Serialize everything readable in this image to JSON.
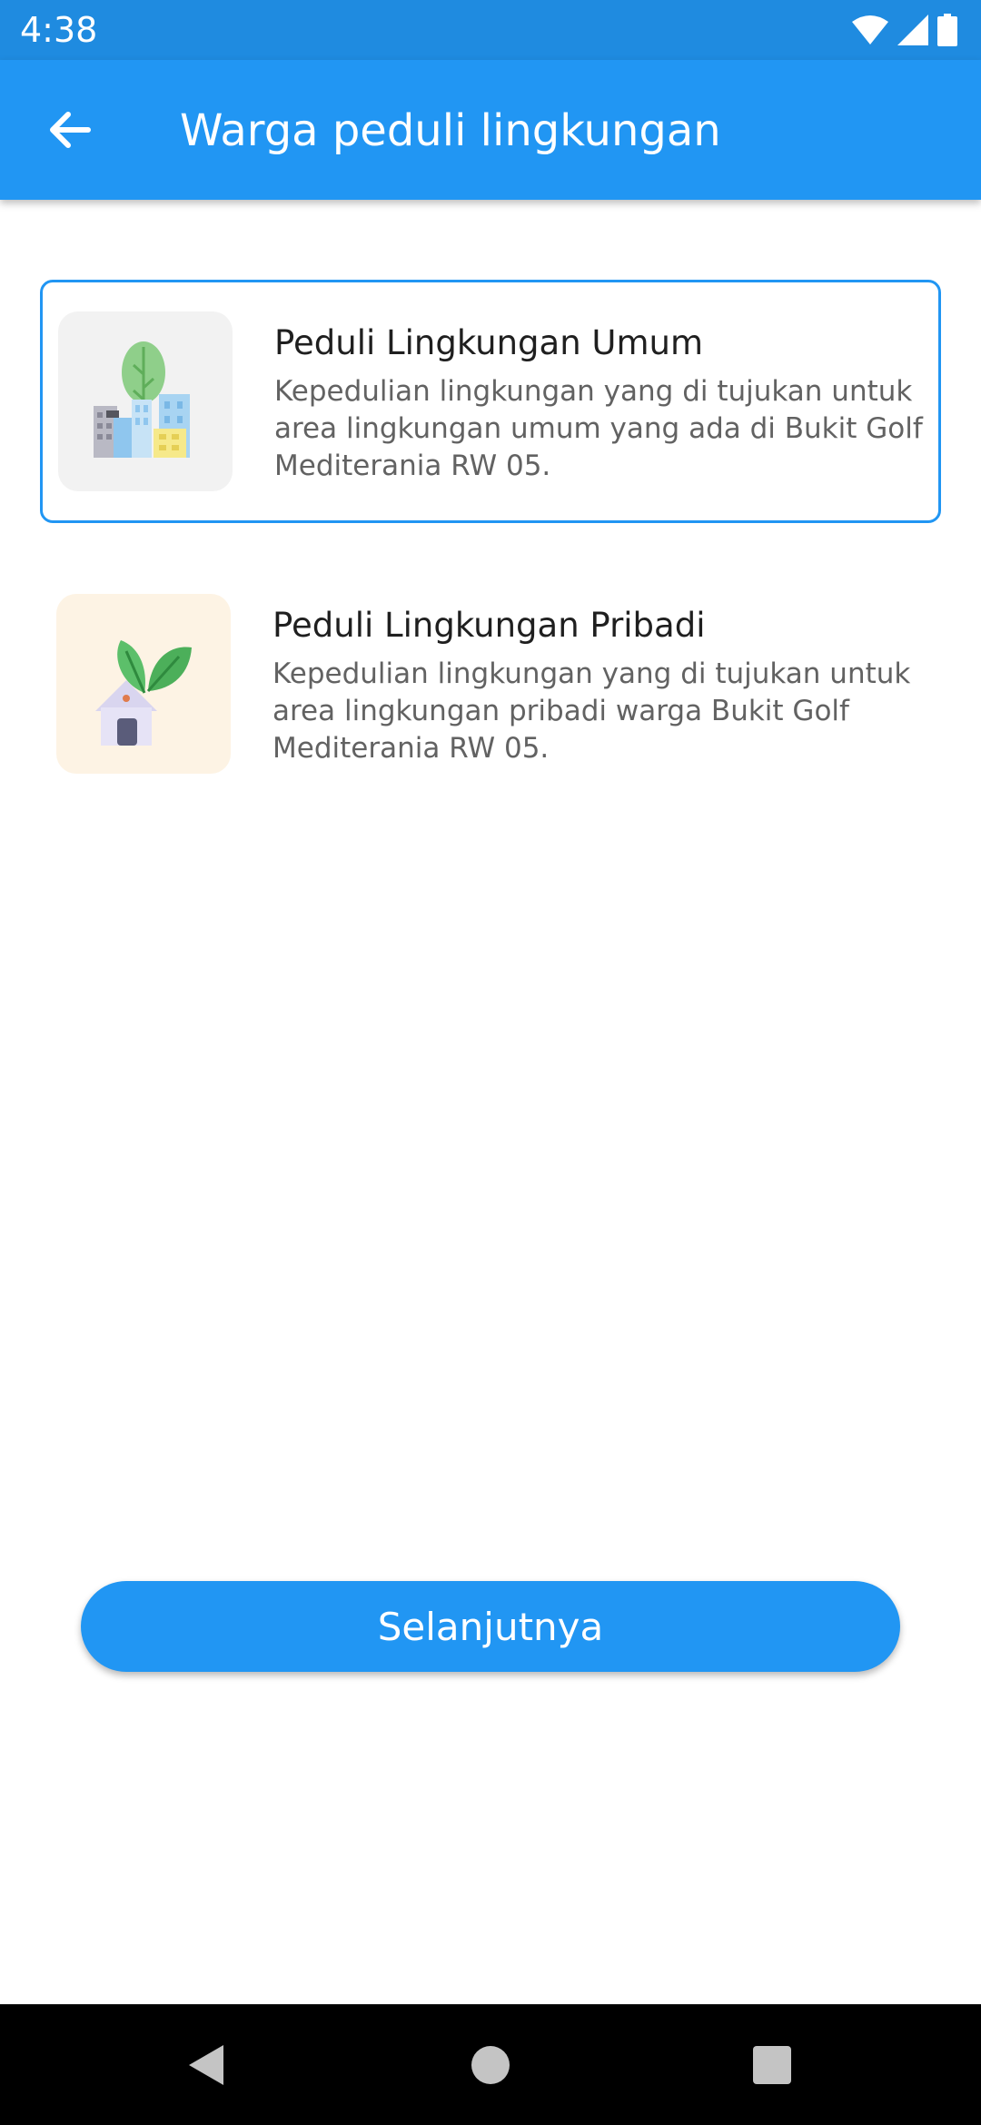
{
  "status_bar": {
    "time": "4:38",
    "icons": [
      "wifi-icon",
      "signal-icon",
      "battery-icon"
    ]
  },
  "app_bar": {
    "title": "Warga peduli lingkungan",
    "back_icon": "arrow-left-icon",
    "color": "#2196f3"
  },
  "options": [
    {
      "title": "Peduli Lingkungan Umum",
      "description": "Kepedulian lingkungan yang di tujukan untuk area lingkungan umum yang ada di Bukit Golf Mediterania RW 05.",
      "icon": "city-tree-icon",
      "selected": true
    },
    {
      "title": "Peduli Lingkungan Pribadi",
      "description": "Kepedulian lingkungan yang di tujukan untuk area lingkungan pribadi warga Bukit Golf Mediterania RW 05.",
      "icon": "house-leaf-icon",
      "selected": false
    }
  ],
  "next_button": {
    "label": "Selanjutnya"
  },
  "nav_bar": {
    "icons": [
      "back-triangle-icon",
      "home-circle-icon",
      "recents-square-icon"
    ]
  }
}
